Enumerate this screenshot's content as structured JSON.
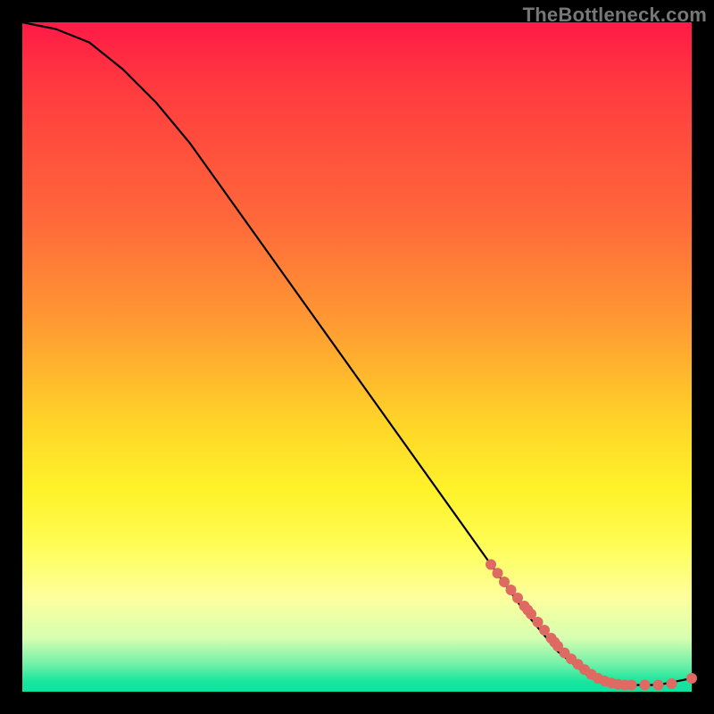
{
  "watermark": "TheBottleneck.com",
  "chart_data": {
    "type": "line",
    "title": "",
    "xlabel": "",
    "ylabel": "",
    "xlim": [
      0,
      100
    ],
    "ylim": [
      0,
      100
    ],
    "grid": false,
    "series": [
      {
        "name": "curve",
        "color": "#000000",
        "x": [
          0,
          5,
          10,
          15,
          20,
          25,
          30,
          35,
          40,
          45,
          50,
          55,
          60,
          65,
          70,
          75,
          80,
          85,
          90,
          95,
          100
        ],
        "y": [
          100,
          99,
          97,
          93,
          88,
          82,
          75,
          68,
          61,
          54,
          47,
          40,
          33,
          26,
          19,
          12,
          6,
          2,
          1,
          1,
          2
        ]
      },
      {
        "name": "dots",
        "color": "#de6a62",
        "type": "scatter",
        "x": [
          70,
          71,
          72,
          73,
          74,
          75,
          75.5,
          76,
          77,
          78,
          79,
          79.5,
          80,
          81,
          82,
          83,
          84,
          85,
          86,
          87,
          88,
          89,
          90,
          91,
          93,
          95,
          97,
          100
        ],
        "y": [
          19.0,
          17.7,
          16.4,
          15.2,
          14.0,
          12.8,
          12.2,
          11.6,
          10.4,
          9.2,
          8.0,
          7.4,
          6.8,
          5.8,
          4.9,
          4.1,
          3.3,
          2.6,
          2.0,
          1.6,
          1.3,
          1.1,
          1.0,
          1.0,
          1.0,
          1.0,
          1.2,
          2.0
        ]
      }
    ]
  }
}
